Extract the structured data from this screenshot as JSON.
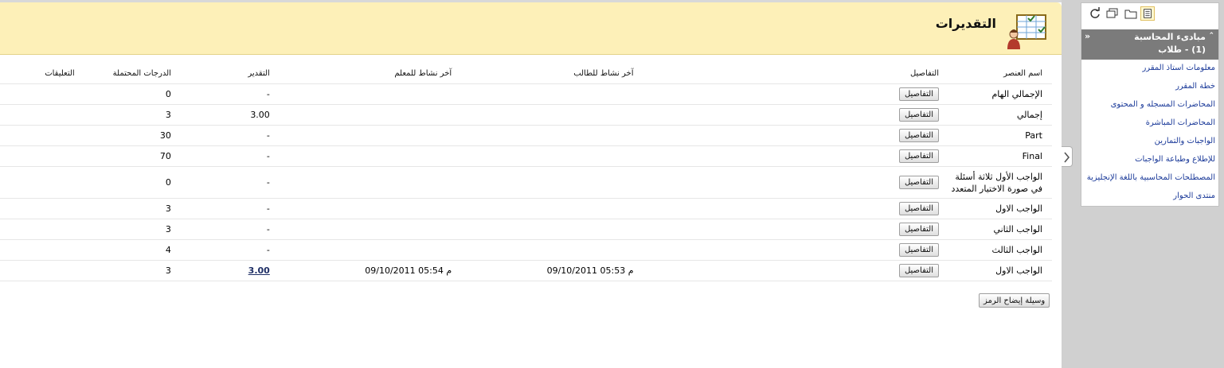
{
  "header": {
    "title": "التقديرات"
  },
  "table": {
    "columns": {
      "name": "اسم العنصر",
      "details": "التفاصيل",
      "student_activity": "آخر نشاط للطالب",
      "teacher_activity": "آخر نشاط للمعلم",
      "grade": "التقدير",
      "possible": "الدرجات المحتملة",
      "comments": "التعليقات"
    },
    "details_label": "التفاصيل",
    "rows": [
      {
        "name": "الإجمالي الهام",
        "student": "",
        "teacher": "",
        "grade": "-",
        "possible": "0",
        "comments": ""
      },
      {
        "name": "إجمالي",
        "student": "",
        "teacher": "",
        "grade": "3.00",
        "possible": "3",
        "comments": ""
      },
      {
        "name": "Part",
        "student": "",
        "teacher": "",
        "grade": "-",
        "possible": "30",
        "comments": ""
      },
      {
        "name": "Final",
        "student": "",
        "teacher": "",
        "grade": "-",
        "possible": "70",
        "comments": ""
      },
      {
        "name": "الواجب الأول ثلاثة أسئلة في صورة الاختيار المتعدد",
        "student": "",
        "teacher": "",
        "grade": "-",
        "possible": "0",
        "comments": ""
      },
      {
        "name": "الواجب الاول",
        "student": "",
        "teacher": "",
        "grade": "-",
        "possible": "3",
        "comments": ""
      },
      {
        "name": "الواجب الثاني",
        "student": "",
        "teacher": "",
        "grade": "-",
        "possible": "3",
        "comments": ""
      },
      {
        "name": "الواجب الثالث",
        "student": "",
        "teacher": "",
        "grade": "-",
        "possible": "4",
        "comments": ""
      },
      {
        "name": "الواجب الاول",
        "student": "09/10/2011 05:53 م",
        "teacher": "09/10/2011 05:54 م",
        "grade": "3.00",
        "possible": "3",
        "comments": ""
      }
    ]
  },
  "legend_button": "وسيلة إيضاح الرمز",
  "sidebar": {
    "course_title": "مبادىء المحاسبة",
    "course_suffix": "(1) - طلاب",
    "items": [
      {
        "label": "معلومات استاذ المقرر"
      },
      {
        "label": "خطة المقرر"
      },
      {
        "label": "المحاضرات المسجله و المحتوى"
      },
      {
        "label": "المحاضرات المباشرة"
      },
      {
        "label": "الواجبات والتمارين"
      },
      {
        "label": "للإطلاع وطباعة الواجبات"
      },
      {
        "label": "المصطلحات المحاسبية باللغة الإنجليزية"
      },
      {
        "label": "منتدى الحوار"
      }
    ]
  },
  "icons": {
    "page": "grades-icon",
    "collapse": "chevron-right-icon",
    "course_toggle": "double-chevron-icon",
    "toolbar": [
      "refresh-icon",
      "windows-icon",
      "folder-icon",
      "list-icon"
    ]
  },
  "colors": {
    "title_bar": "#fdf0b8",
    "course_header": "#7b7b7b",
    "link": "#1b3a99"
  }
}
